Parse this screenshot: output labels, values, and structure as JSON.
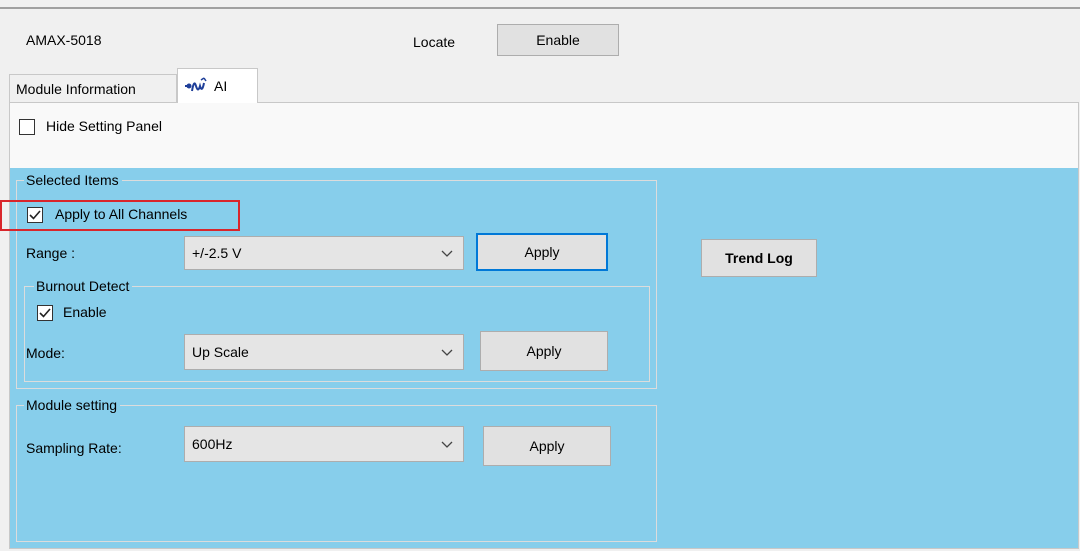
{
  "header": {
    "module_name": "AMAX-5018",
    "locate_label": "Locate",
    "enable_button": "Enable"
  },
  "tabs": [
    {
      "label": "Module Information",
      "active": false
    },
    {
      "label": "AI",
      "active": true,
      "icon": "waveform-icon"
    }
  ],
  "hide_panel": {
    "label": "Hide Setting Panel",
    "checked": false
  },
  "selected_items": {
    "title": "Selected Items",
    "apply_all": {
      "label": "Apply to All Channels",
      "checked": true
    },
    "range": {
      "label": "Range :",
      "value": "+/-2.5 V",
      "apply": "Apply"
    },
    "burnout": {
      "title": "Burnout Detect",
      "enable": {
        "label": "Enable",
        "checked": true
      },
      "mode": {
        "label": "Mode:",
        "value": "Up Scale",
        "apply": "Apply"
      }
    }
  },
  "module_setting": {
    "title": "Module setting",
    "sampling": {
      "label": "Sampling Rate:",
      "value": "600Hz",
      "apply": "Apply"
    }
  },
  "trend_log_button": "Trend Log",
  "colors": {
    "panel_blue": "#87ceeb",
    "highlight_red": "#d9262b",
    "focus_blue": "#0078d7"
  }
}
